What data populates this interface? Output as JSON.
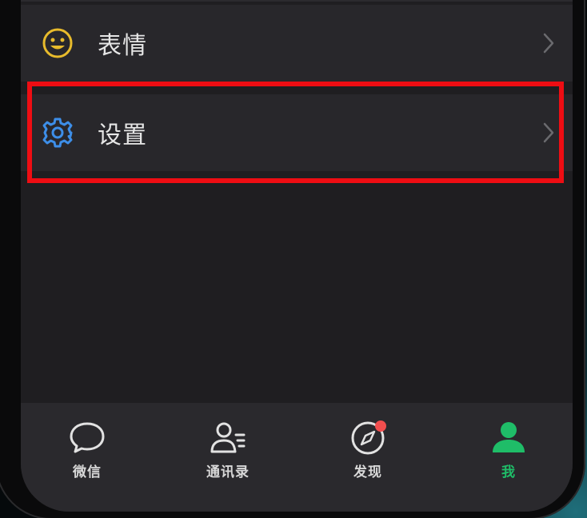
{
  "menu": {
    "items": [
      {
        "label": "表情",
        "icon": "smiley-icon",
        "icon_color": "#e8bb2c"
      },
      {
        "label": "设置",
        "icon": "gear-icon",
        "icon_color": "#3d8ee8"
      }
    ]
  },
  "tabbar": {
    "tabs": [
      {
        "label": "微信",
        "icon": "chat-bubble-icon",
        "active": false
      },
      {
        "label": "通讯录",
        "icon": "contacts-icon",
        "active": false
      },
      {
        "label": "发现",
        "icon": "compass-icon",
        "active": false,
        "badge": true
      },
      {
        "label": "我",
        "icon": "person-icon",
        "active": true
      }
    ]
  },
  "colors": {
    "background": "#1f1e21",
    "row_background": "#28272b",
    "highlight": "#ee0d13",
    "active_tab": "#1fbd68",
    "badge": "#f24e4e"
  }
}
